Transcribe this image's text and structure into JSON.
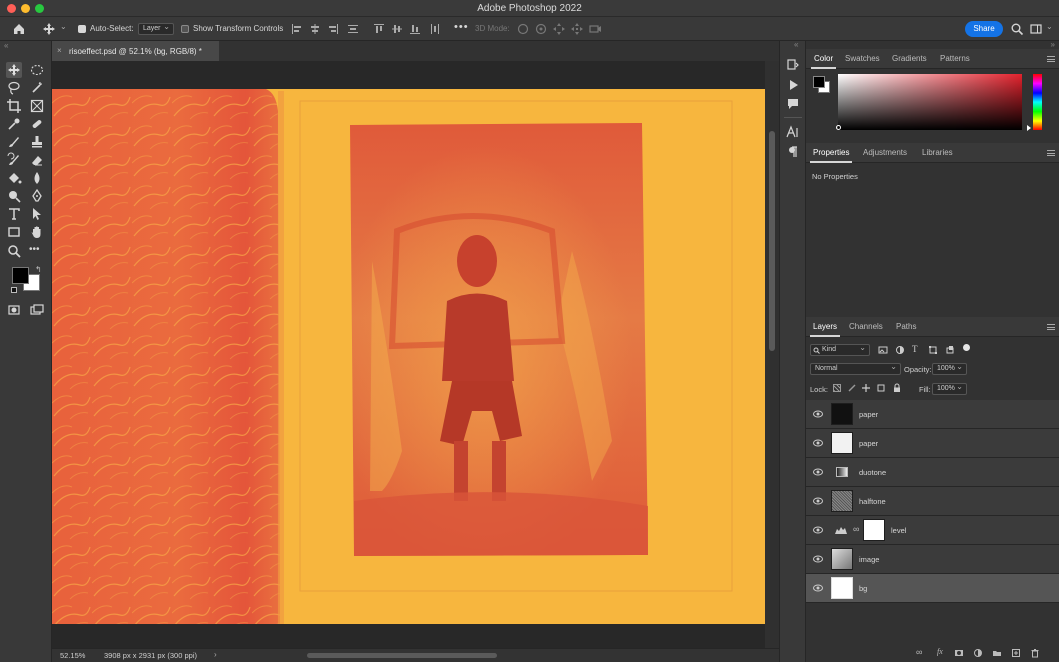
{
  "app": {
    "title": "Adobe Photoshop 2022"
  },
  "options": {
    "auto_select_label": "Auto-Select:",
    "auto_select_value": "Layer",
    "show_transform_label": "Show Transform Controls",
    "mode_3d_label": "3D Mode:",
    "share_label": "Share"
  },
  "document": {
    "tab_title": "risoeffect.psd @ 52.1% (bg, RGB/8) *",
    "zoom": "52.15%",
    "info": "3908 px x 2931 px (300 ppi)"
  },
  "color_panel": {
    "tabs": [
      "Color",
      "Swatches",
      "Gradients",
      "Patterns"
    ]
  },
  "properties_panel": {
    "tabs": [
      "Properties",
      "Adjustments",
      "Libraries"
    ],
    "empty_text": "No Properties"
  },
  "layers_panel": {
    "tabs": [
      "Layers",
      "Channels",
      "Paths"
    ],
    "filter_kind": "Kind",
    "blend_mode": "Normal",
    "opacity_label": "Opacity:",
    "opacity_value": "100%",
    "lock_label": "Lock:",
    "fill_label": "Fill:",
    "fill_value": "100%",
    "layers": [
      {
        "name": "paper",
        "thumb": "#111111"
      },
      {
        "name": "paper",
        "thumb": "#f2f2f2"
      },
      {
        "name": "duotone",
        "thumb": "gradient"
      },
      {
        "name": "halftone",
        "thumb": "pattern"
      },
      {
        "name": "level",
        "thumb": "#ffffff"
      },
      {
        "name": "image",
        "thumb": "photo"
      },
      {
        "name": "bg",
        "thumb": "#ffffff"
      }
    ]
  },
  "colors": {
    "accent": "#1473e6",
    "canvas_yellow": "#f7b53d",
    "canvas_red": "#e45a3a"
  }
}
